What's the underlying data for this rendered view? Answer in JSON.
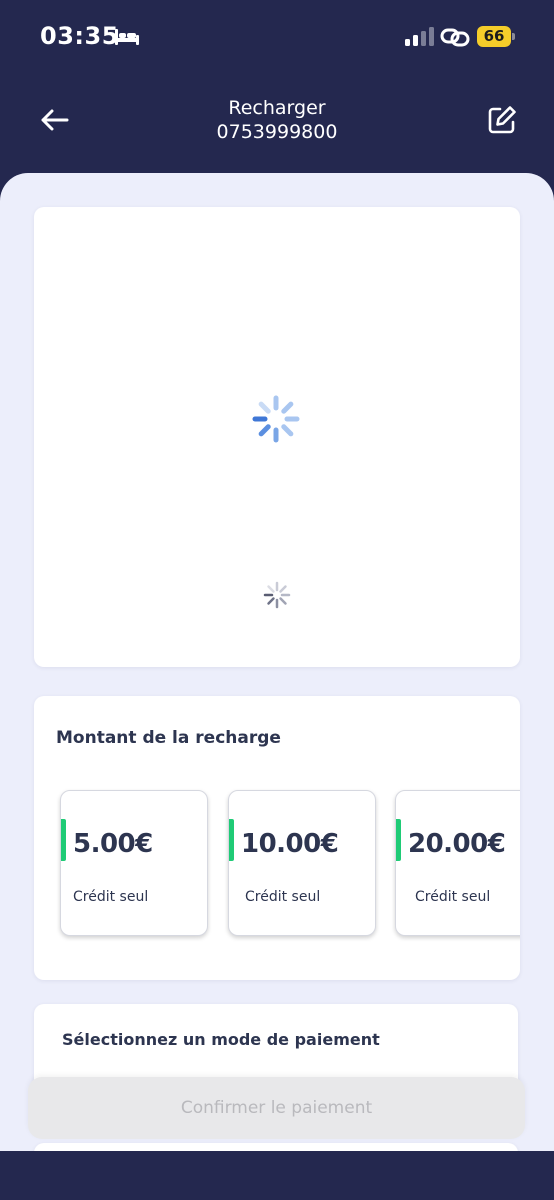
{
  "status_bar": {
    "time": "03:35",
    "battery": "66",
    "icons": [
      "bed-icon",
      "signal-icon",
      "link-icon",
      "battery-icon"
    ]
  },
  "header": {
    "title": "Recharger",
    "subtitle": "0753999800",
    "back_icon": "arrow-left-icon",
    "edit_icon": "edit-icon"
  },
  "amount": {
    "title": "Montant de la recharge",
    "options": [
      {
        "value": "5.00€",
        "label": "Crédit seul"
      },
      {
        "value": "10.00€",
        "label": "Crédit seul"
      },
      {
        "value": "20.00€",
        "label": "Crédit seul"
      }
    ]
  },
  "payment": {
    "title": "Sélectionnez un mode de paiement"
  },
  "confirm_label": "Confirmer le paiement",
  "colors": {
    "header_bg": "#24284f",
    "content_bg": "#eceefb",
    "accent": "#1fcb76",
    "text_dark": "#2d3550",
    "battery": "#f5cd2a"
  }
}
